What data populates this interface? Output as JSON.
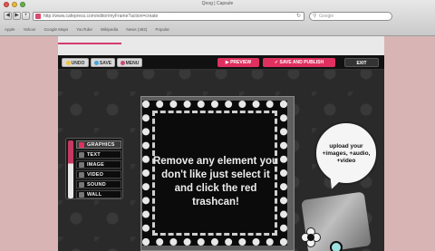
{
  "window": {
    "title": "Qoog | Capsule",
    "url": "http://www.cafepress.com/editor/myFrame?action=create",
    "search_placeholder": "Google",
    "bookmarks": [
      "Apple",
      "Yahoo!",
      "Google Maps",
      "YouTube",
      "Wikipedia",
      "News (482)",
      "Popular"
    ]
  },
  "toolbar": {
    "buttons": [
      {
        "label": "UNDO",
        "color": "#f2c23a"
      },
      {
        "label": "SAVE",
        "color": "#4aa4d8"
      },
      {
        "label": "MENU",
        "color": "#c84a7a"
      }
    ],
    "preview_label": "PREVIEW",
    "save_publish_label": "SAVE AND PUBLISH",
    "exit_label": "EXIT"
  },
  "palette": {
    "items": [
      {
        "label": "GRAPHICS",
        "active": true
      },
      {
        "label": "TEXT"
      },
      {
        "label": "IMAGE"
      },
      {
        "label": "VIDEO"
      },
      {
        "label": "SOUND"
      },
      {
        "label": "WALL"
      }
    ]
  },
  "canvas": {
    "frame_text": "Remove any element you don't like just select it and click the red trashcan!",
    "bubble_text": "upload your +images, +audio, +video"
  },
  "colors": {
    "accent": "#e0305f",
    "page_bg": "#d8b4b4",
    "editor_bg": "#2a2a2a"
  }
}
